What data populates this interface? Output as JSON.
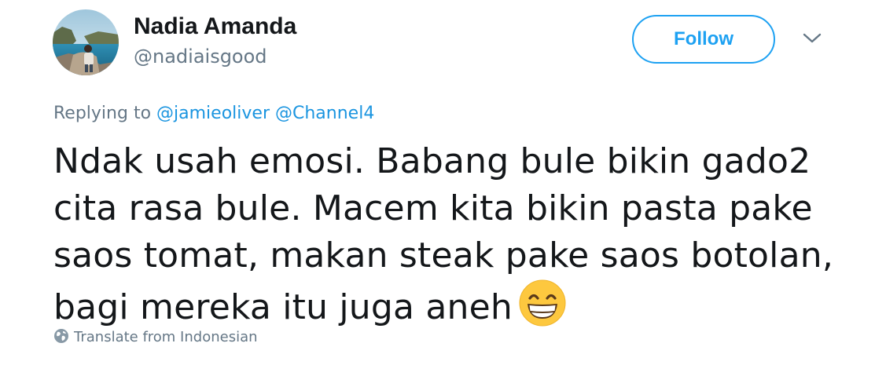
{
  "user": {
    "display_name": "Nadia Amanda",
    "handle": "@nadiaisgood",
    "avatar_icon": "profile-photo"
  },
  "actions": {
    "follow_label": "Follow",
    "menu_icon": "chevron-down-icon"
  },
  "reply": {
    "prefix": "Replying to",
    "mentions": [
      "@jamieoliver",
      "@Channel4"
    ]
  },
  "tweet": {
    "lines": [
      "Ndak usah emosi. Babang bule bikin gado2",
      "cita rasa bule. Macem kita bikin pasta pake",
      "saos tomat, makan steak pake saos botolan,",
      "bagi mereka itu juga aneh"
    ],
    "emoji": "grinning-face-with-smiling-eyes"
  },
  "translate": {
    "label": "Translate from Indonesian",
    "icon": "globe-icon"
  },
  "colors": {
    "accent": "#1da1f2",
    "link": "#1b95e0",
    "secondary_text": "#657786",
    "primary_text": "#14171a"
  }
}
